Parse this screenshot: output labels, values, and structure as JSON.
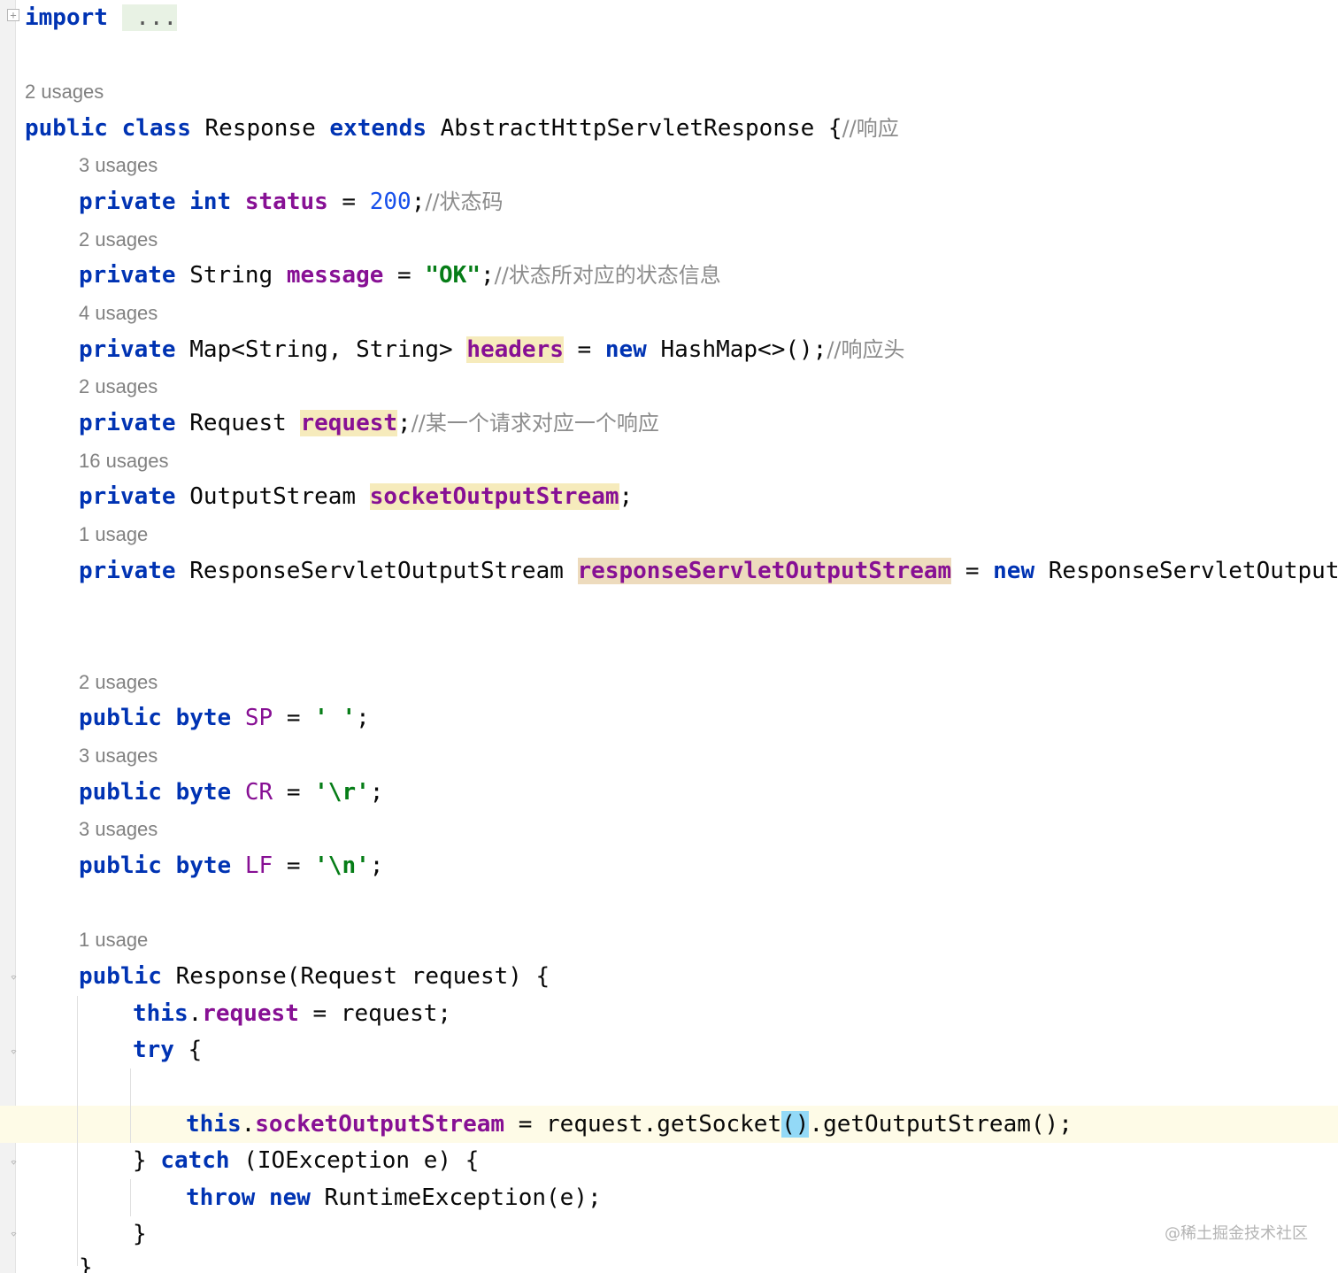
{
  "editor": {
    "line_import": {
      "keyword": "import",
      "folded": " ..."
    },
    "hint_class": "2 usages",
    "line_class": {
      "kw1": "public",
      "kw2": "class",
      "name": "Response",
      "kw3": "extends",
      "parent": "AbstractHttpServletResponse",
      "brace": " {",
      "comment": "//响应"
    },
    "hint_status": "3 usages",
    "line_status": {
      "kw1": "private",
      "kw2": "int",
      "field": "status",
      "eq": " = ",
      "num": "200",
      "semi": ";",
      "comment": "//状态码"
    },
    "hint_message": "2 usages",
    "line_message": {
      "kw1": "private",
      "type": " String ",
      "field": "message",
      "eq": " = ",
      "str": "\"OK\"",
      "semi": ";",
      "comment": "//状态所对应的状态信息"
    },
    "hint_headers": "4 usages",
    "line_headers": {
      "kw1": "private",
      "type": " Map<String, String> ",
      "field": "headers",
      "eq": " = ",
      "kw2": "new",
      "rest": " HashMap<>();",
      "comment": "//响应头"
    },
    "hint_request": "2 usages",
    "line_request": {
      "kw1": "private",
      "type": " Request ",
      "field": "request",
      "semi": ";",
      "comment": "//某一个请求对应一个响应"
    },
    "hint_socket": "16 usages",
    "line_socket": {
      "kw1": "private",
      "type": " OutputStream ",
      "field": "socketOutputStream",
      "semi": ";"
    },
    "hint_rsos": "1 usage",
    "line_rsos": {
      "kw1": "private",
      "type": " ResponseServletOutputStream ",
      "field": "responseServletOutputStream",
      "eq": " = ",
      "kw2": "new",
      "rest": " ResponseServletOutputStr"
    },
    "hint_sp": "2 usages",
    "line_sp": {
      "kw1": "public",
      "kw2": "byte",
      "field": "SP",
      "eq": " = ",
      "str": "' '",
      "semi": ";"
    },
    "hint_cr": "3 usages",
    "line_cr": {
      "kw1": "public",
      "kw2": "byte",
      "field": "CR",
      "eq": " = ",
      "str": "'\\r'",
      "semi": ";"
    },
    "hint_lf": "3 usages",
    "line_lf": {
      "kw1": "public",
      "kw2": "byte",
      "field": "LF",
      "eq": " = ",
      "str": "'\\n'",
      "semi": ";"
    },
    "hint_ctor": "1 usage",
    "line_ctor": {
      "kw1": "public",
      "rest": " Response(Request request) {"
    },
    "line_assign": {
      "kw1": "this",
      "dot": ".",
      "field": "request",
      "rest": " = request;"
    },
    "line_try": {
      "kw1": "try",
      "rest": " {"
    },
    "line_socket_assign": {
      "kw1": "this",
      "dot": ".",
      "field": "socketOutputStream",
      "mid": " = request.getSocket",
      "paren": "()",
      "rest": ".getOutputStream();"
    },
    "line_catch": {
      "pre": "} ",
      "kw1": "catch",
      "rest": " (IOException e) {"
    },
    "line_throw": {
      "kw1": "throw",
      "kw2": "new",
      "rest": " RuntimeException(e);"
    },
    "line_close": "}",
    "line_partial": "}"
  },
  "watermark": "@稀土掘金技术社区",
  "colors": {
    "keyword": "#0033b3",
    "field": "#871094",
    "string": "#067d17",
    "number": "#1750eb",
    "comment": "#8c8c8c",
    "highlight": "#f6ebbc",
    "caret_row": "#fefbe7",
    "brace_match": "#93d9f7"
  }
}
